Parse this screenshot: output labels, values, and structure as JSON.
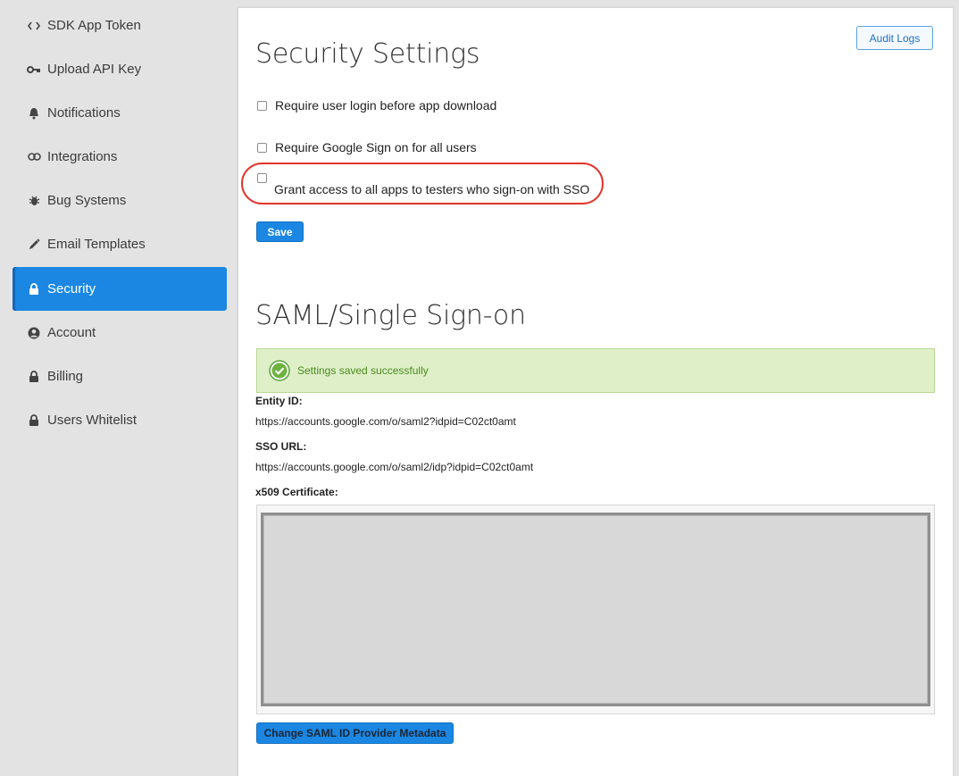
{
  "sidebar": {
    "items": [
      {
        "label": "SDK App Token",
        "icon": "code-icon"
      },
      {
        "label": "Upload API Key",
        "icon": "key-icon"
      },
      {
        "label": "Notifications",
        "icon": "bell-icon"
      },
      {
        "label": "Integrations",
        "icon": "link-icon"
      },
      {
        "label": "Bug Systems",
        "icon": "bug-icon"
      },
      {
        "label": "Email Templates",
        "icon": "pencil-icon"
      },
      {
        "label": "Security",
        "icon": "lock-icon",
        "active": true
      },
      {
        "label": "Account",
        "icon": "user-circle-icon"
      },
      {
        "label": "Billing",
        "icon": "lock-icon"
      },
      {
        "label": "Users Whitelist",
        "icon": "lock-icon"
      }
    ]
  },
  "security": {
    "title": "Security Settings",
    "audit_logs": "Audit Logs",
    "options": [
      {
        "label": "Require user login before app download",
        "checked": false
      },
      {
        "label": "Require Google Sign on for all users",
        "checked": false
      },
      {
        "label": "Grant access to all apps to testers who sign-on with SSO",
        "checked": false
      }
    ],
    "save": "Save"
  },
  "saml": {
    "title": "SAML/Single Sign-on",
    "success_message": "Settings saved successfully",
    "entity_id_label": "Entity ID:",
    "entity_id": "https://accounts.google.com/o/saml2?idpid=C02ct0amt",
    "sso_url_label": "SSO URL:",
    "sso_url": "https://accounts.google.com/o/saml2/idp?idpid=C02ct0amt",
    "cert_label": "x509 Certificate:",
    "change_button": "Change SAML ID Provider Metadata"
  },
  "colors": {
    "accent": "#1b87e3",
    "success_bg": "#dff0c8",
    "success_text": "#4a8a1e",
    "highlight": "#e2342c"
  }
}
